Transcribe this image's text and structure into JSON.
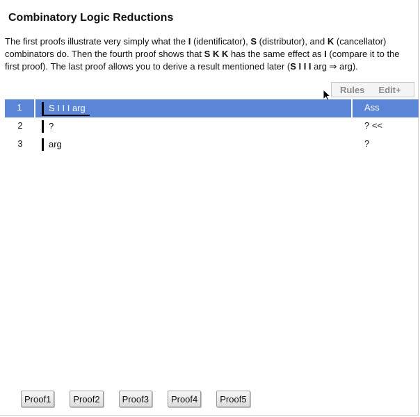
{
  "page": {
    "title": "Combinatory Logic Reductions",
    "description": {
      "p1": "The first proofs illustrate very simply what the ",
      "I": "I",
      "p2": " (identificator), ",
      "S": "S",
      "p3": " (distributor), and ",
      "K": "K",
      "p4": " (cancellator) combinators do. Then the fourth proof shows that ",
      "SKK": "S K K",
      "p5": " has the same effect as ",
      "I2": "I",
      "p6": " (compare it to the first proof). The last proof allows you to derive a result mentioned later (",
      "SIII": "S I I I",
      "p7": " arg ⇒ arg)."
    }
  },
  "toolbar": {
    "rules_label": "Rules",
    "edit_label": "Edit+"
  },
  "proof": {
    "rows": [
      {
        "num": "1",
        "formula": "S I I I arg",
        "rule": "Ass"
      },
      {
        "num": "2",
        "formula": "?",
        "rule": "? <<"
      },
      {
        "num": "3",
        "formula": "arg",
        "rule": "?"
      }
    ]
  },
  "buttons": [
    "Proof1",
    "Proof2",
    "Proof3",
    "Proof4",
    "Proof5"
  ],
  "colors": {
    "selected_row": "#5b86d8",
    "toolbar_text": "#8a8a8a"
  }
}
